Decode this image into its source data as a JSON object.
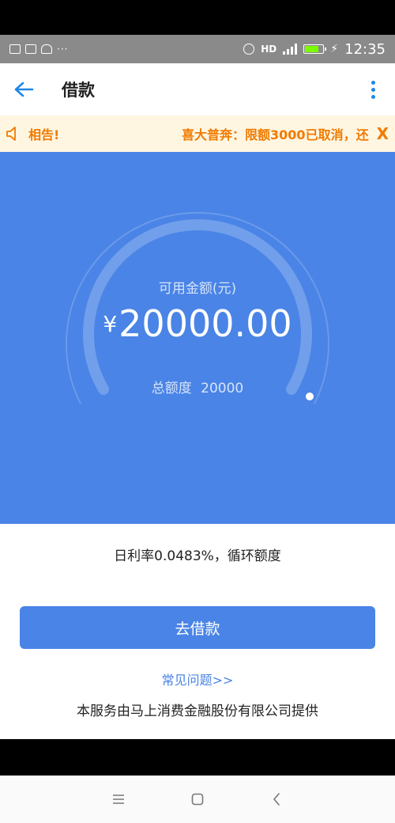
{
  "status_bar": {
    "left_icons": [
      "gallery-icon",
      "message-icon",
      "cloud-icon"
    ],
    "left_dots": "···",
    "hd": "HD",
    "time": "12:35"
  },
  "app_bar": {
    "title": "借款"
  },
  "notice": {
    "text_left": "相告!",
    "text_right": "喜大普奔：限额3000已取消，还",
    "close": "X"
  },
  "hero": {
    "label": "可用金额(元)",
    "currency": "¥",
    "amount": "20000.00",
    "total_label": "总额度",
    "total_value": "20000",
    "gauge_level": 1.0
  },
  "info": {
    "rate_text": "日利率0.0483%，循环额度"
  },
  "actions": {
    "loan_button": "去借款",
    "faq_link": "常见问题>>"
  },
  "footer": {
    "provider": "本服务由马上消费金融股份有限公司提供"
  },
  "colors": {
    "primary": "#4a84e6",
    "accent_blue": "#1e88e5",
    "notice_bg": "#fff6e2",
    "notice_text": "#f07b00"
  }
}
